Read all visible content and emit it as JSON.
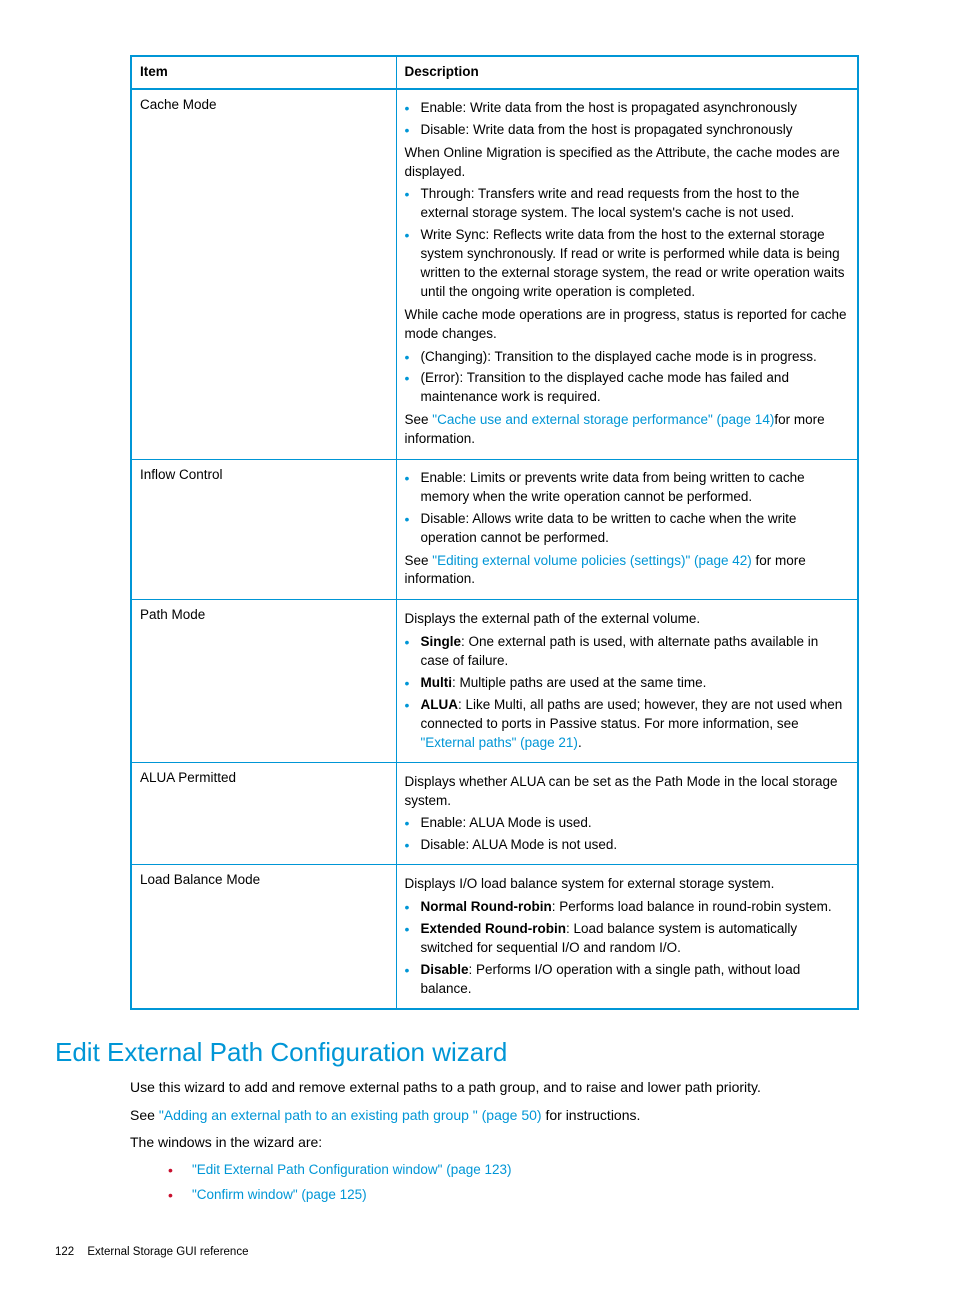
{
  "table": {
    "headers": {
      "item": "Item",
      "description": "Description"
    },
    "rows": [
      {
        "item": "Cache Mode",
        "desc": {
          "b1": "Enable: Write data from the host is propagated asynchronously",
          "b2": "Disable: Write data from the host is propagated synchronously",
          "p1": "When Online Migration is specified as the Attribute, the cache modes are displayed.",
          "b3": "Through: Transfers write and read requests from the host to the external storage system. The local system's cache is not used.",
          "b4": "Write Sync: Reflects write data from the host to the external storage system synchronously. If read or write is performed while data is being written to the external storage system, the read or write operation waits until the ongoing write operation is completed.",
          "p2": "While cache mode operations are in progress, status is reported for cache mode changes.",
          "b5": "(Changing): Transition to the displayed cache mode is in progress.",
          "b6": "(Error): Transition to the displayed cache mode has failed and maintenance work is required.",
          "p3a": "See ",
          "p3link": "\"Cache use and external storage performance\" (page 14)",
          "p3b": "for more information."
        }
      },
      {
        "item": "Inflow Control",
        "desc": {
          "b1": "Enable: Limits or prevents write data from being written to cache memory when the write operation cannot be performed.",
          "b2": "Disable: Allows write data to be written to cache when the write operation cannot be performed.",
          "p1a": "See ",
          "p1link": "\"Editing external volume policies (settings)\" (page 42)",
          "p1b": " for more information."
        }
      },
      {
        "item": "Path Mode",
        "desc": {
          "p1": "Displays the external path of the external volume.",
          "b1s": "Single",
          "b1r": ": One external path is used, with alternate paths available in case of failure.",
          "b2s": "Multi",
          "b2r": ": Multiple paths are used at the same time.",
          "b3s": "ALUA",
          "b3r": ": Like Multi, all paths are used; however, they are not used when connected to ports in Passive status. For more information, see ",
          "b3link": "\"External paths\" (page 21)",
          "b3end": "."
        }
      },
      {
        "item": "ALUA Permitted",
        "desc": {
          "p1": "Displays whether ALUA can be set as the Path Mode in the local storage system.",
          "b1": "Enable: ALUA Mode is used.",
          "b2": "Disable: ALUA Mode is not used."
        }
      },
      {
        "item": "Load Balance Mode",
        "desc": {
          "p1": "Displays I/O load balance system for external storage system.",
          "b1s": "Normal Round-robin",
          "b1r": ": Performs load balance in round-robin system.",
          "b2s": "Extended Round-robin",
          "b2r": ": Load balance system is automatically switched for sequential I/O and random I/O.",
          "b3s": "Disable",
          "b3r": ": Performs I/O operation with a single path, without load balance."
        }
      }
    ]
  },
  "section": {
    "title": "Edit External Path Configuration wizard",
    "p1": "Use this wizard to add and remove external paths to a path group, and to raise and lower path priority.",
    "p2a": "See ",
    "p2link": "\"Adding an external path to an existing path group \" (page 50)",
    "p2b": " for instructions.",
    "p3": "The windows in the wizard are:",
    "l1": "\"Edit External Path Configuration window\" (page 123)",
    "l2": "\"Confirm window\" (page 125)"
  },
  "footer": {
    "page": "122",
    "title": "External Storage GUI reference"
  }
}
